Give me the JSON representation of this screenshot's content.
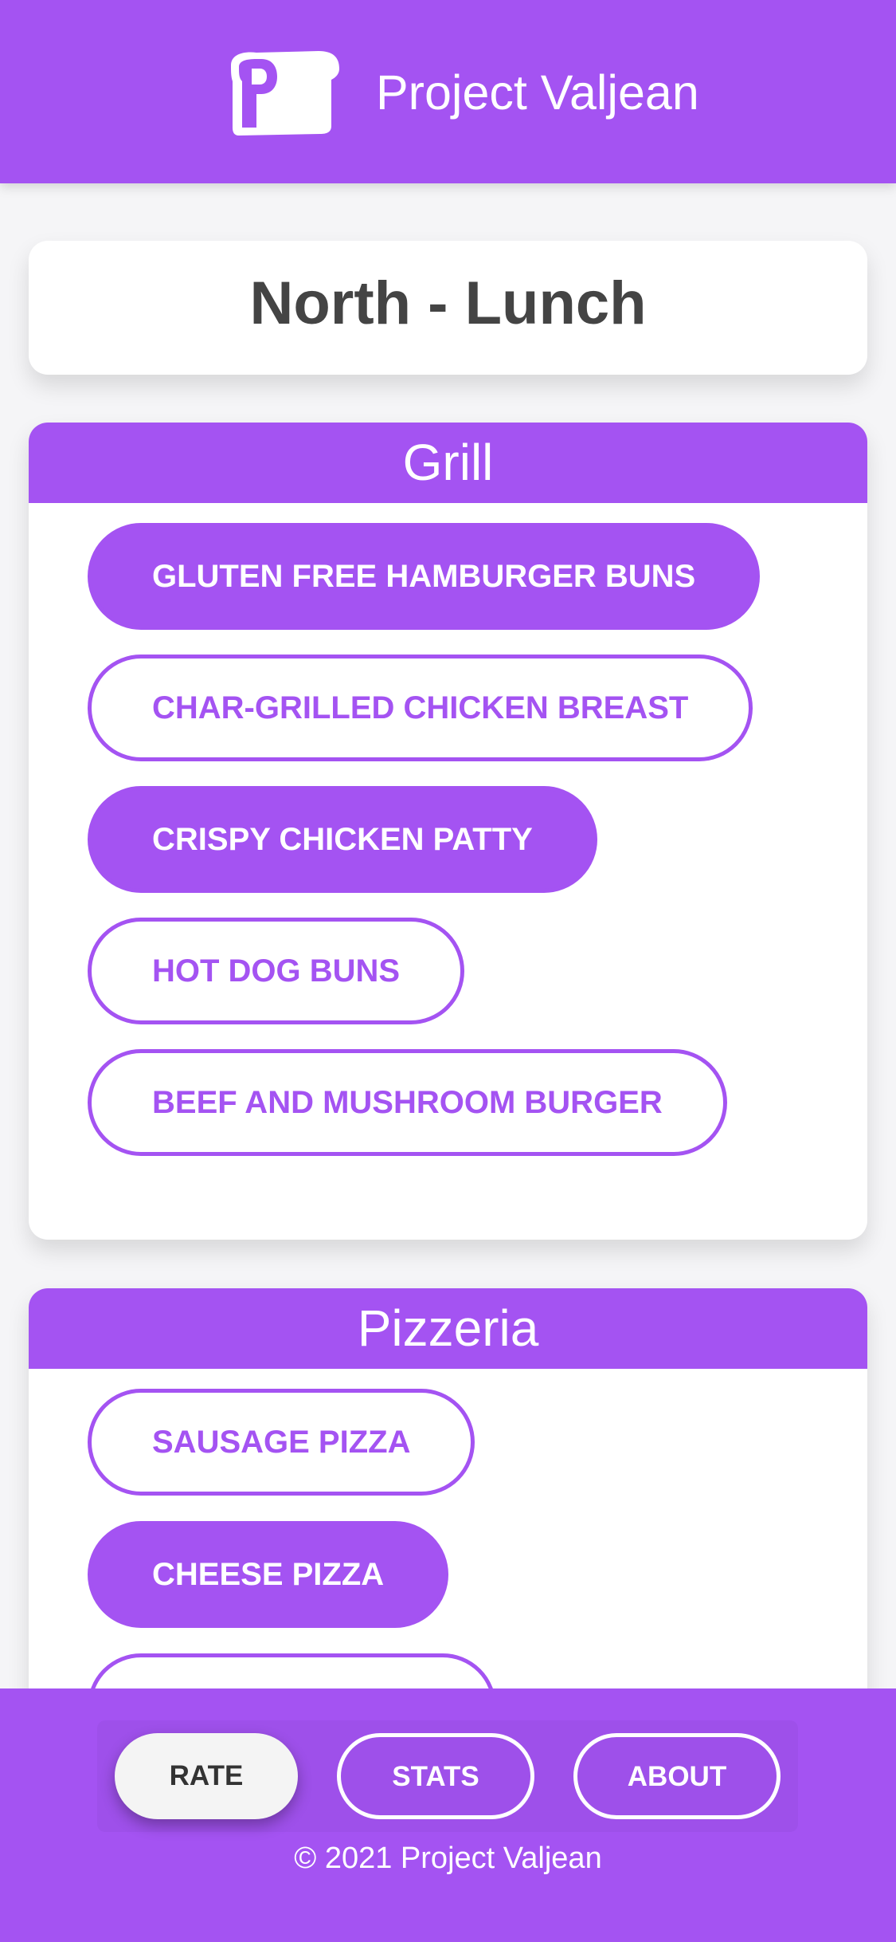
{
  "header": {
    "logo_icon": "bread-p-logo-icon",
    "title": "Project Valjean"
  },
  "page": {
    "title": "North - Lunch"
  },
  "stations": [
    {
      "name": "Grill",
      "items": [
        {
          "label": "GLUTEN FREE HAMBURGER BUNS",
          "selected": true
        },
        {
          "label": "CHAR-GRILLED CHICKEN BREAST",
          "selected": false
        },
        {
          "label": "CRISPY CHICKEN PATTY",
          "selected": true
        },
        {
          "label": "HOT DOG BUNS",
          "selected": false
        },
        {
          "label": "BEEF AND MUSHROOM BURGER",
          "selected": false
        }
      ]
    },
    {
      "name": "Pizzeria",
      "items": [
        {
          "label": "SAUSAGE PIZZA",
          "selected": false
        },
        {
          "label": "CHEESE PIZZA",
          "selected": true
        },
        {
          "label": "",
          "selected": false
        }
      ]
    }
  ],
  "nav": {
    "rate": "RATE",
    "stats": "STATS",
    "about": "ABOUT",
    "active": "RATE"
  },
  "footer": {
    "copyright": "© 2021 Project Valjean"
  },
  "colors": {
    "accent": "#a453f2",
    "background": "#f5f5f7",
    "title_text": "#444444"
  }
}
